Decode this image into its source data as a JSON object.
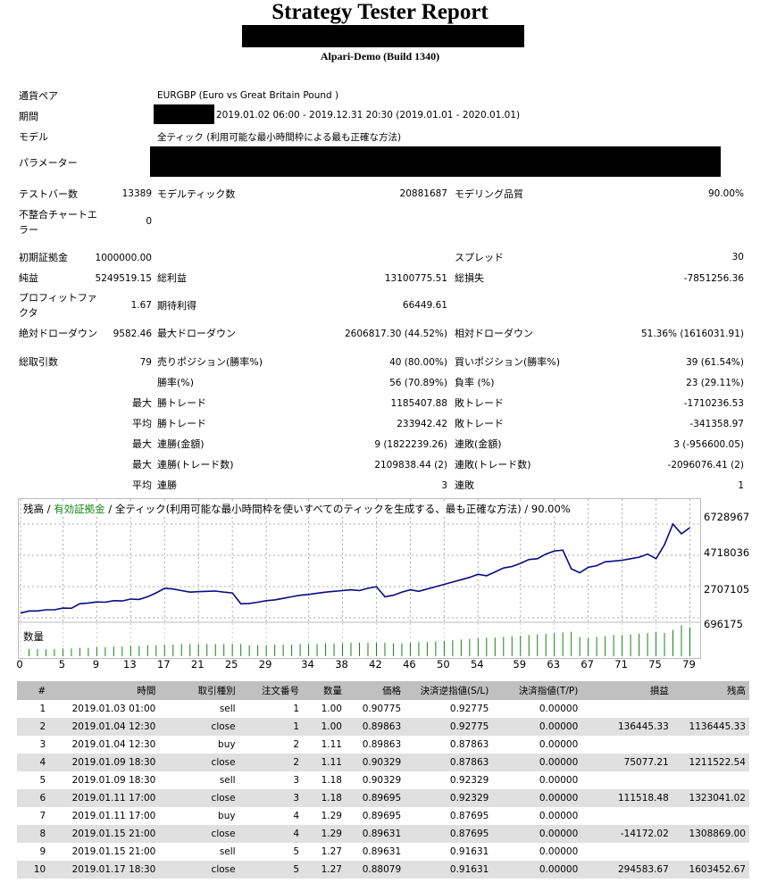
{
  "report": {
    "title": "Strategy Tester Report",
    "server": "Alpari-Demo (Build 1340)"
  },
  "settings": {
    "symbol_label": "通貨ペア",
    "symbol_value": "EURGBP (Euro vs Great Britain Pound )",
    "period_label": "期間",
    "period_value": "2019.01.02 06:00 - 2019.12.31 20:30 (2019.01.01 - 2020.01.01)",
    "model_label": "モデル",
    "model_value": "全ティック (利用可能な最小時間枠による最も正確な方法)",
    "params_label": "パラメーター"
  },
  "stats": {
    "bars_label": "テストバー数",
    "bars_value": "13389",
    "ticks_label": "モデルティック数",
    "ticks_value": "20881687",
    "quality_label": "モデリング品質",
    "quality_value": "90.00%",
    "mismatch_label_1": "不整合チャートエ",
    "mismatch_label_2": "ラー",
    "mismatch_value": "0",
    "deposit_label": "初期証拠金",
    "deposit_value": "1000000.00",
    "spread_label": "スプレッド",
    "spread_value": "30",
    "net_label": "純益",
    "net_value": "5249519.15",
    "gross_profit_label": "総利益",
    "gross_profit_value": "13100775.51",
    "gross_loss_label": "総損失",
    "gross_loss_value": "-7851256.36",
    "pf_label_1": "プロフィットファ",
    "pf_label_2": "クタ",
    "pf_value": "1.67",
    "expected_label": "期待利得",
    "expected_value": "66449.61",
    "abs_dd_label": "絶対ドローダウン",
    "abs_dd_value": "9582.46",
    "max_dd_label": "最大ドローダウン",
    "max_dd_value": "2606817.30 (44.52%)",
    "rel_dd_label": "相対ドローダウン",
    "rel_dd_value": "51.36% (1616031.91)",
    "trades_label": "総取引数",
    "trades_value": "79",
    "short_label": "売りポジション(勝率%)",
    "short_value": "40 (80.00%)",
    "long_label": "買いポジション(勝率%)",
    "long_value": "39 (61.54%)",
    "win_rate_label": "勝率(%)",
    "win_rate_value": "56 (70.89%)",
    "loss_rate_label": "負率 (%)",
    "loss_rate_value": "23 (29.11%)",
    "max_label": "最大",
    "avg_label": "平均",
    "max_win_label": "勝トレード",
    "max_win_value": "1185407.88",
    "max_loss_label": "敗トレード",
    "max_loss_value": "-1710236.53",
    "avg_win_label": "勝トレード",
    "avg_win_value": "233942.42",
    "avg_loss_label": "敗トレード",
    "avg_loss_value": "-341358.97",
    "max_cw_label": "連勝(金額)",
    "max_cw_value": "9 (1822239.26)",
    "max_cl_label": "連敗(金額)",
    "max_cl_value": "3 (-956600.05)",
    "max_cwt_label": "連勝(トレード数)",
    "max_cwt_value": "2109838.44 (2)",
    "max_clt_label": "連敗(トレード数)",
    "max_clt_value": "-2096076.41 (2)",
    "avg_cw_label": "連勝",
    "avg_cw_value": "3",
    "avg_cl_label": "連敗",
    "avg_cl_value": "1"
  },
  "chart_legend": {
    "balance": "残高",
    "sep1": " / ",
    "equity": "有効証拠金",
    "rest": " / 全ティック(利用可能な最小時間枠を使いすべてのティックを生成する、最も正確な方法) / 90.00%",
    "volume_label": "数量"
  },
  "colors": {
    "balance_line": "#0a0a80",
    "volume_bar": "#118811",
    "header_bg": "#c0c0c0",
    "alt_row": "#e0e0e0"
  },
  "chart_data": {
    "type": "line",
    "title": "",
    "yticks": [
      "6728967",
      "4718036",
      "2707105",
      "696175"
    ],
    "xticks": [
      "0",
      "5",
      "9",
      "13",
      "17",
      "21",
      "25",
      "29",
      "34",
      "38",
      "42",
      "46",
      "50",
      "54",
      "59",
      "63",
      "67",
      "71",
      "75",
      "79"
    ],
    "ylim": [
      696175,
      6728967
    ],
    "xlim": [
      0,
      80
    ],
    "series": [
      {
        "name": "残高",
        "x": [
          0,
          1,
          2,
          3,
          4,
          5,
          6,
          7,
          8,
          9,
          10,
          11,
          12,
          13,
          14,
          15,
          16,
          17,
          18,
          19,
          20,
          21,
          22,
          23,
          24,
          25,
          26,
          27,
          28,
          29,
          30,
          31,
          32,
          33,
          34,
          35,
          36,
          37,
          38,
          39,
          40,
          41,
          42,
          43,
          44,
          45,
          46,
          47,
          48,
          49,
          50,
          51,
          52,
          53,
          54,
          55,
          56,
          57,
          58,
          59,
          60,
          61,
          62,
          63,
          64,
          65,
          66,
          67,
          68,
          69,
          70,
          71,
          72,
          73,
          74,
          75,
          76,
          77,
          78,
          79
        ],
        "values": [
          1000000,
          1136445,
          1136445,
          1211522,
          1211522,
          1323041,
          1308869,
          1603452,
          1650000,
          1720000,
          1700000,
          1800000,
          1780000,
          1900000,
          1880000,
          2050000,
          2300000,
          2600000,
          2550000,
          2450000,
          2350000,
          2380000,
          2400000,
          2420000,
          2350000,
          2300000,
          1600000,
          1620000,
          1700000,
          1800000,
          1850000,
          1950000,
          2050000,
          2150000,
          2200000,
          2280000,
          2350000,
          2400000,
          2450000,
          2500000,
          2450000,
          2600000,
          2700000,
          2050000,
          2150000,
          2350000,
          2500000,
          2400000,
          2550000,
          2700000,
          2850000,
          3000000,
          3150000,
          3300000,
          3500000,
          3400000,
          3650000,
          3900000,
          4000000,
          4200000,
          4450000,
          4500000,
          4800000,
          5000000,
          5050000,
          3850000,
          3600000,
          3950000,
          4050000,
          4300000,
          4350000,
          4400000,
          4500000,
          4600000,
          4800000,
          4500000,
          5400000,
          6728967,
          6100000,
          6500000
        ]
      }
    ],
    "volume": [
      1,
      1,
      1,
      1,
      1,
      1,
      1,
      1,
      1,
      1,
      1,
      1,
      1,
      1,
      1,
      1,
      1,
      1,
      1,
      1,
      1,
      1,
      1,
      1,
      1,
      1,
      1,
      1,
      1,
      1,
      1,
      1,
      1,
      1,
      1,
      1,
      1,
      1,
      1,
      1,
      1,
      1,
      1,
      1,
      1,
      1,
      1,
      1,
      1,
      1,
      1,
      1,
      1,
      1,
      1,
      1,
      1,
      1,
      1,
      1,
      1,
      1,
      1,
      1,
      1,
      1,
      1,
      1,
      1,
      1,
      1,
      1,
      1,
      1,
      1,
      1,
      1,
      1,
      1
    ],
    "volume_levels": [
      0.22,
      0.22,
      0.22,
      0.22,
      0.24,
      0.24,
      0.26,
      0.26,
      0.28,
      0.28,
      0.3,
      0.3,
      0.32,
      0.32,
      0.34,
      0.34,
      0.36,
      0.36,
      0.38,
      0.38,
      0.38,
      0.38,
      0.38,
      0.38,
      0.38,
      0.38,
      0.34,
      0.34,
      0.34,
      0.36,
      0.36,
      0.36,
      0.38,
      0.38,
      0.38,
      0.4,
      0.4,
      0.4,
      0.42,
      0.42,
      0.42,
      0.42,
      0.42,
      0.4,
      0.4,
      0.42,
      0.44,
      0.44,
      0.46,
      0.48,
      0.5,
      0.52,
      0.54,
      0.56,
      0.58,
      0.58,
      0.6,
      0.62,
      0.64,
      0.66,
      0.68,
      0.7,
      0.72,
      0.74,
      0.76,
      0.6,
      0.56,
      0.6,
      0.62,
      0.66,
      0.66,
      0.68,
      0.7,
      0.72,
      0.76,
      0.72,
      0.82,
      0.96,
      0.9
    ]
  },
  "table": {
    "headers": [
      "#",
      "時間",
      "取引種別",
      "注文番号",
      "数量",
      "価格",
      "決済逆指値(S/L)",
      "決済指値(T/P)",
      "損益",
      "残高"
    ],
    "rows": [
      [
        "1",
        "2019.01.03 01:00",
        "sell",
        "1",
        "1.00",
        "0.90775",
        "0.92775",
        "0.00000",
        "",
        ""
      ],
      [
        "2",
        "2019.01.04 12:30",
        "close",
        "1",
        "1.00",
        "0.89863",
        "0.92775",
        "0.00000",
        "136445.33",
        "1136445.33"
      ],
      [
        "3",
        "2019.01.04 12:30",
        "buy",
        "2",
        "1.11",
        "0.89863",
        "0.87863",
        "0.00000",
        "",
        ""
      ],
      [
        "4",
        "2019.01.09 18:30",
        "close",
        "2",
        "1.11",
        "0.90329",
        "0.87863",
        "0.00000",
        "75077.21",
        "1211522.54"
      ],
      [
        "5",
        "2019.01.09 18:30",
        "sell",
        "3",
        "1.18",
        "0.90329",
        "0.92329",
        "0.00000",
        "",
        ""
      ],
      [
        "6",
        "2019.01.11 17:00",
        "close",
        "3",
        "1.18",
        "0.89695",
        "0.92329",
        "0.00000",
        "111518.48",
        "1323041.02"
      ],
      [
        "7",
        "2019.01.11 17:00",
        "buy",
        "4",
        "1.29",
        "0.89695",
        "0.87695",
        "0.00000",
        "",
        ""
      ],
      [
        "8",
        "2019.01.15 21:00",
        "close",
        "4",
        "1.29",
        "0.89631",
        "0.87695",
        "0.00000",
        "-14172.02",
        "1308869.00"
      ],
      [
        "9",
        "2019.01.15 21:00",
        "sell",
        "5",
        "1.27",
        "0.89631",
        "0.91631",
        "0.00000",
        "",
        ""
      ],
      [
        "10",
        "2019.01.17 18:30",
        "close",
        "5",
        "1.27",
        "0.88079",
        "0.91631",
        "0.00000",
        "294583.67",
        "1603452.67"
      ]
    ]
  }
}
